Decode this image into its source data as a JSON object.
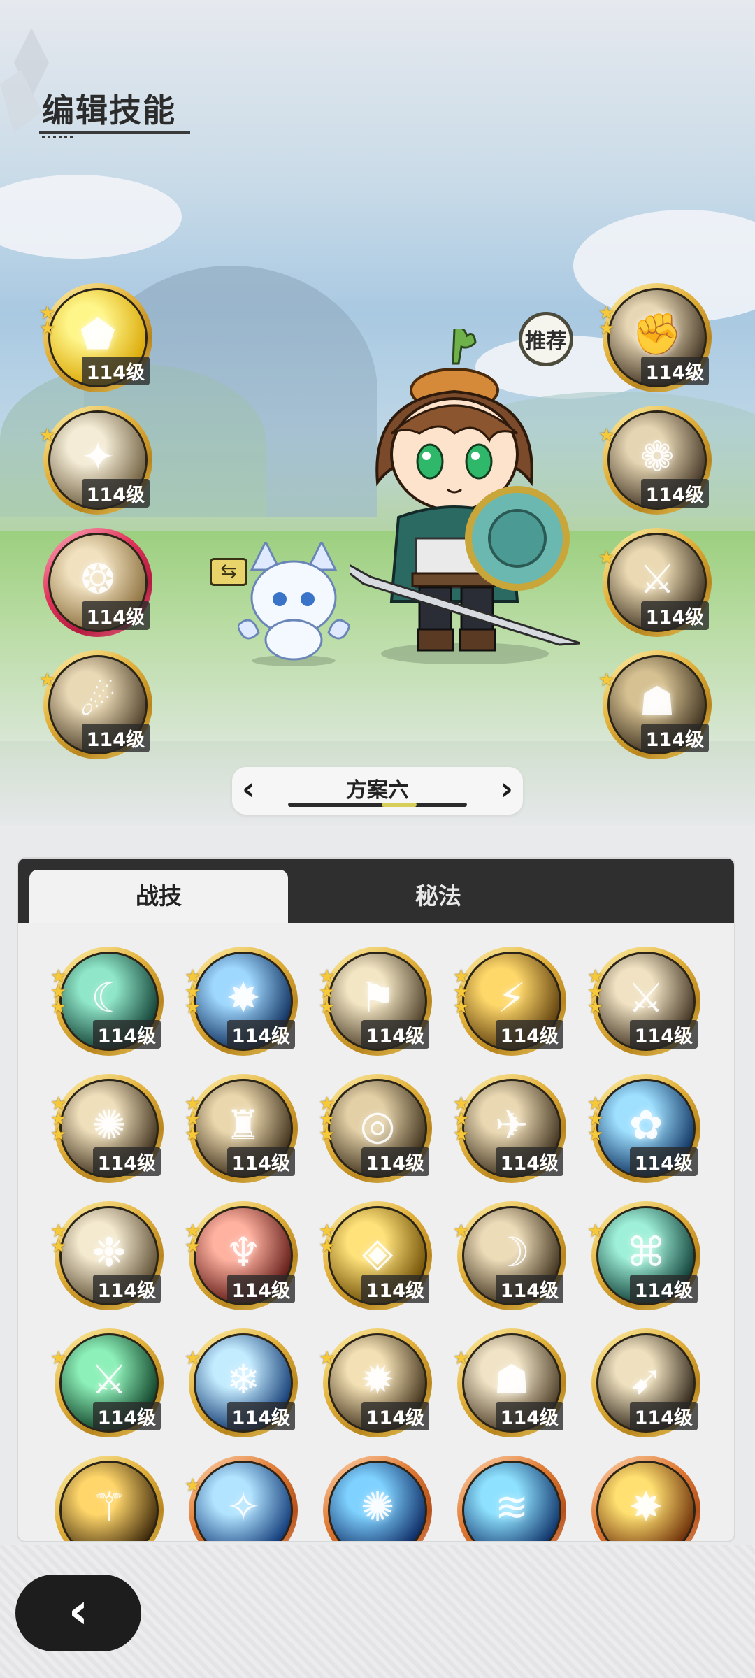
{
  "page": {
    "title": "编辑技能"
  },
  "scene": {
    "recommend_label": "推荐",
    "swap_icon": "swap-arrows-icon"
  },
  "left_skills": [
    {
      "level": "114级",
      "stars": 2,
      "glyph": "⬟",
      "bg": [
        "#fff68a",
        "#d9a400"
      ],
      "ring": "gold"
    },
    {
      "level": "114级",
      "stars": 1,
      "glyph": "✦",
      "bg": [
        "#f4ecd6",
        "#6b5a3a"
      ],
      "ring": "gold"
    },
    {
      "level": "114级",
      "stars": 0,
      "glyph": "❂",
      "bg": [
        "#f1e1bf",
        "#8a6d3b"
      ],
      "ring": "red"
    },
    {
      "level": "114级",
      "stars": 1,
      "glyph": "☄",
      "bg": [
        "#e9d9b5",
        "#4b3b25"
      ],
      "ring": "gold"
    }
  ],
  "right_skills": [
    {
      "level": "114级",
      "stars": 2,
      "glyph": "✊",
      "bg": [
        "#e8d7b4",
        "#3c2f1e"
      ],
      "ring": "gold"
    },
    {
      "level": "114级",
      "stars": 1,
      "glyph": "❁",
      "bg": [
        "#e5d5b2",
        "#403222"
      ],
      "ring": "gold"
    },
    {
      "level": "114级",
      "stars": 1,
      "glyph": "⚔",
      "bg": [
        "#ead9b2",
        "#3e311f"
      ],
      "ring": "gold"
    },
    {
      "level": "114级",
      "stars": 1,
      "glyph": "☗",
      "bg": [
        "#d6c192",
        "#3b2e1c"
      ],
      "ring": "gold"
    }
  ],
  "plan_selector": {
    "label": "方案六",
    "prev_icon": "chevron-left-icon",
    "next_icon": "chevron-right-icon",
    "progress": 0.6
  },
  "tabs": [
    {
      "label": "战技",
      "active": true
    },
    {
      "label": "秘法",
      "active": false
    }
  ],
  "skill_grid": [
    {
      "level": "114级",
      "stars": 3,
      "glyph": "☾",
      "bg": [
        "#8fe6c8",
        "#0d3a2f"
      ],
      "ring": "gold"
    },
    {
      "level": "114级",
      "stars": 3,
      "glyph": "✸",
      "bg": [
        "#9fd8ff",
        "#0a2a5a"
      ],
      "ring": "gold"
    },
    {
      "level": "114级",
      "stars": 3,
      "glyph": "⚑",
      "bg": [
        "#f3e6c4",
        "#4a3b24"
      ],
      "ring": "gold"
    },
    {
      "level": "114级",
      "stars": 3,
      "glyph": "⚡",
      "bg": [
        "#ffd86a",
        "#5a3a0a"
      ],
      "ring": "gold"
    },
    {
      "level": "114级",
      "stars": 3,
      "glyph": "⚔",
      "bg": [
        "#f0e2c2",
        "#3c2e1c"
      ],
      "ring": "gold"
    },
    {
      "level": "114级",
      "stars": 3,
      "glyph": "✺",
      "bg": [
        "#efdfbb",
        "#3b2c18"
      ],
      "ring": "gold"
    },
    {
      "level": "114级",
      "stars": 3,
      "glyph": "♜",
      "bg": [
        "#ead7ad",
        "#3a2b16"
      ],
      "ring": "gold"
    },
    {
      "level": "114级",
      "stars": 3,
      "glyph": "◎",
      "bg": [
        "#e3d0a6",
        "#3a2c18"
      ],
      "ring": "gold"
    },
    {
      "level": "114级",
      "stars": 3,
      "glyph": "✈",
      "bg": [
        "#e9d8b2",
        "#3b2d1a"
      ],
      "ring": "gold"
    },
    {
      "level": "114级",
      "stars": 3,
      "glyph": "✿",
      "bg": [
        "#9fe0ff",
        "#0b2f5e"
      ],
      "ring": "gold"
    },
    {
      "level": "114级",
      "stars": 2,
      "glyph": "❉",
      "bg": [
        "#f4ead0",
        "#5a4a2f"
      ],
      "ring": "gold"
    },
    {
      "level": "114级",
      "stars": 2,
      "glyph": "♆",
      "bg": [
        "#ffb2a0",
        "#5a1410"
      ],
      "ring": "gold"
    },
    {
      "level": "114级",
      "stars": 2,
      "glyph": "◈",
      "bg": [
        "#ffe27a",
        "#6b4a00"
      ],
      "ring": "gold"
    },
    {
      "level": "114级",
      "stars": 1,
      "glyph": "☽",
      "bg": [
        "#eddcb8",
        "#3a2c18"
      ],
      "ring": "gold"
    },
    {
      "level": "114级",
      "stars": 1,
      "glyph": "⌘",
      "bg": [
        "#9ff0d8",
        "#0b3a33"
      ],
      "ring": "gold"
    },
    {
      "level": "114级",
      "stars": 1,
      "glyph": "⚔",
      "bg": [
        "#8df0b8",
        "#0a3a22"
      ],
      "ring": "gold"
    },
    {
      "level": "114级",
      "stars": 1,
      "glyph": "❄",
      "bg": [
        "#c4ecff",
        "#0c3570"
      ],
      "ring": "gold"
    },
    {
      "level": "114级",
      "stars": 1,
      "glyph": "✹",
      "bg": [
        "#f3e0b4",
        "#3c2c15"
      ],
      "ring": "gold"
    },
    {
      "level": "114级",
      "stars": 1,
      "glyph": "☗",
      "bg": [
        "#f1e4c6",
        "#4a3a24"
      ],
      "ring": "gold"
    },
    {
      "level": "114级",
      "stars": 0,
      "glyph": "➹",
      "bg": [
        "#efe1bf",
        "#2b2114"
      ],
      "ring": "gold"
    },
    {
      "level": "",
      "stars": 0,
      "glyph": "⚚",
      "bg": [
        "#ffd66a",
        "#3a2508"
      ],
      "ring": "gold"
    },
    {
      "level": "",
      "stars": 1,
      "glyph": "✧",
      "bg": [
        "#b2e4ff",
        "#0b3575"
      ],
      "ring": "orange"
    },
    {
      "level": "",
      "stars": 0,
      "glyph": "✺",
      "bg": [
        "#7fd2ff",
        "#0a2660"
      ],
      "ring": "orange"
    },
    {
      "level": "",
      "stars": 0,
      "glyph": "≋",
      "bg": [
        "#8fe2ff",
        "#0b2e66"
      ],
      "ring": "orange"
    },
    {
      "level": "",
      "stars": 0,
      "glyph": "✸",
      "bg": [
        "#ffe070",
        "#6a2a05"
      ],
      "ring": "orange"
    }
  ],
  "back_button": {
    "icon": "chevron-left-icon"
  }
}
